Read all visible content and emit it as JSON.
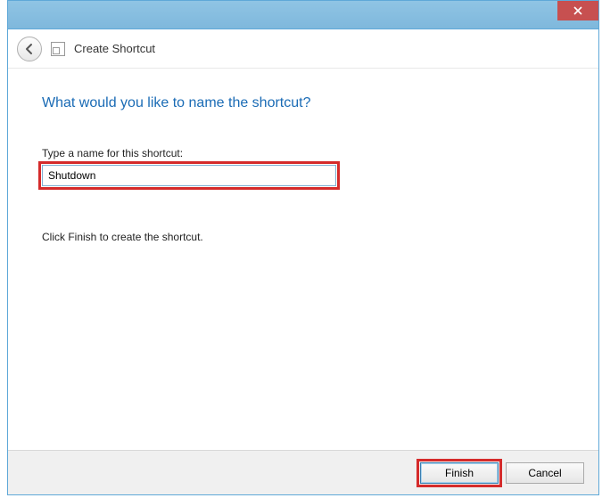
{
  "window": {
    "title": "Create Shortcut"
  },
  "wizard": {
    "heading": "What would you like to name the shortcut?",
    "field_label": "Type a name for this shortcut:",
    "input_value": "Shutdown",
    "instruction": "Click Finish to create the shortcut."
  },
  "buttons": {
    "finish": "Finish",
    "cancel": "Cancel"
  }
}
